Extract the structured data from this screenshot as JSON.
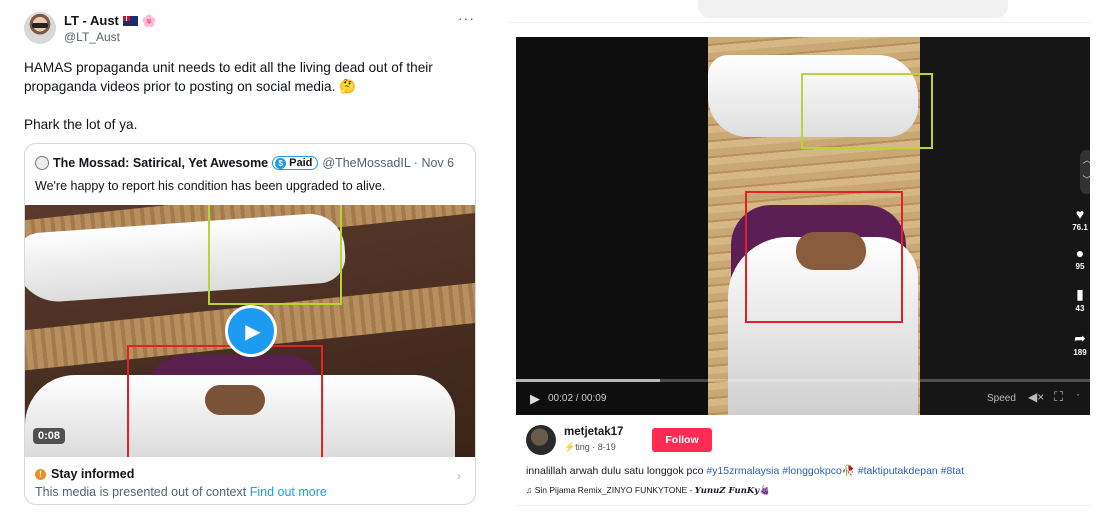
{
  "tweet": {
    "name": "LT - Aust",
    "name_emoji": "🌸",
    "handle": "@LT_Aust",
    "more": "···",
    "text": "HAMAS propaganda unit needs to edit all the living dead out of their propaganda videos prior to posting on social media. 🤔",
    "text2": "Phark the lot of ya.",
    "quote": {
      "name": "The Mossad: Satirical, Yet Awesome",
      "paid": "Paid",
      "paid_icon": "$",
      "meta": "@TheMossadIL · Nov 6",
      "text": "We're happy to report his condition has been upgraded to alive.",
      "play_icon": "▶",
      "duration": "0:08",
      "notice_title": "Stay informed",
      "notice_icon": "!",
      "notice_text": "This media is presented out of context",
      "notice_link": "Find out more",
      "chevron": "›"
    }
  },
  "tiktok": {
    "player": {
      "play_icon": "▶",
      "time": "00:02 / 00:09",
      "progress": 0.25,
      "speed": "Speed",
      "mute_icon": "◀×",
      "fullscreen_icon": "⛶",
      "more_icon": "·"
    },
    "nav": {
      "up": "︿",
      "down": "﹀"
    },
    "actions": [
      {
        "name": "like",
        "icon": "♥",
        "count": "76.1"
      },
      {
        "name": "comment",
        "icon": "●",
        "count": "95"
      },
      {
        "name": "save",
        "icon": "▮",
        "count": "43"
      },
      {
        "name": "share",
        "icon": "➦",
        "count": "189"
      }
    ],
    "username": "metjetak17",
    "sub": "⚡ting · 8-19",
    "follow": "Follow",
    "caption_text": "innalillah arwah dulu satu longgok pco ",
    "caption_tags": "#y15zrmalaysia #longgokpco🥀 #taktiputakdepan #8tat",
    "music_prefix": "♫ Sin Pijama Remix_ZINYO FUNKYTONE - ",
    "music_sig": "𝒀𝒖𝒏𝒖𝒁 𝑭𝒖𝒏𝑲𝒚🍇"
  }
}
